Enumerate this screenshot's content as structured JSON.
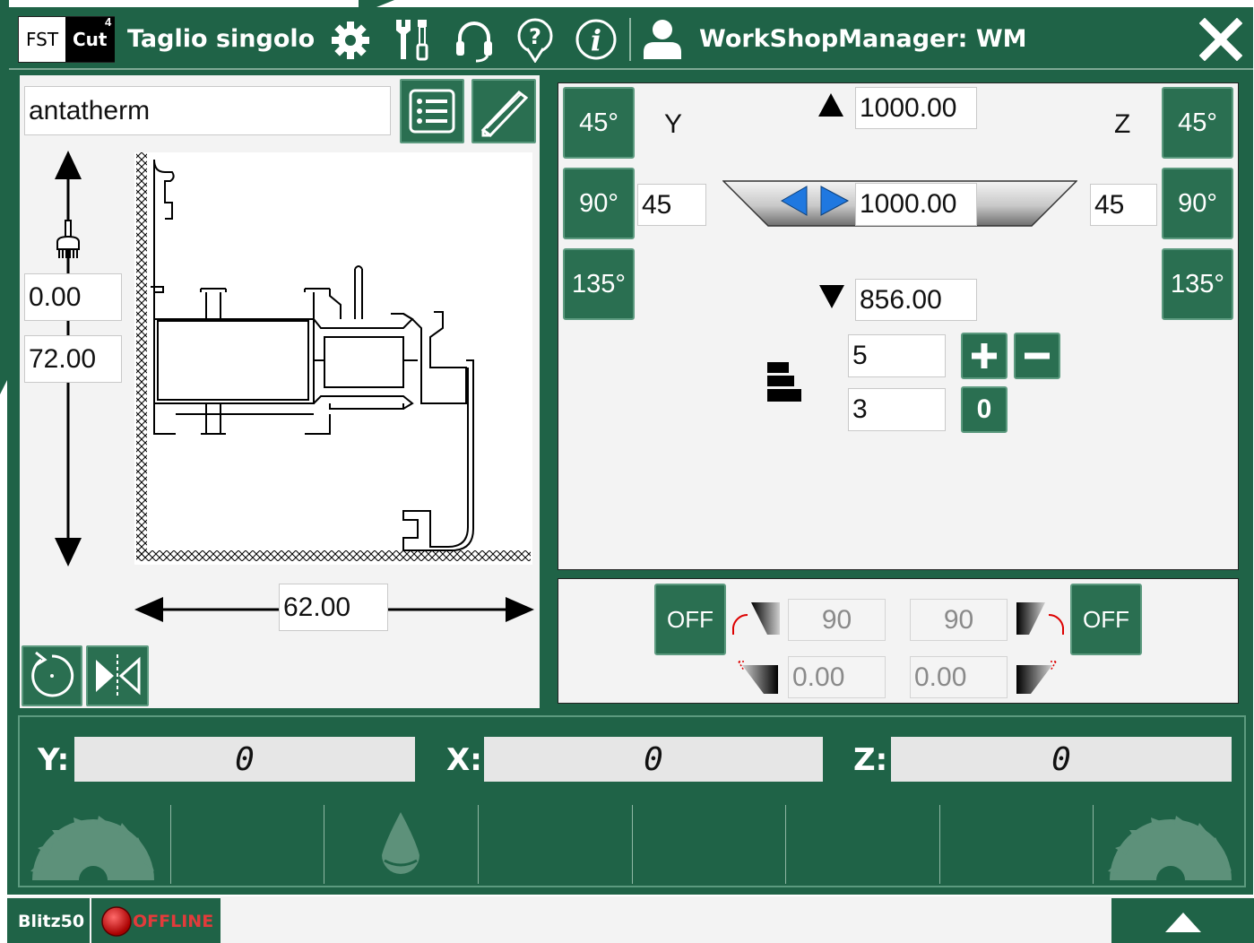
{
  "header": {
    "logo_fst": "FST",
    "logo_cut": "Cut",
    "logo_sup": "4",
    "title": "Taglio singolo",
    "user": "WorkShopManager: WM",
    "icons": [
      "gear-icon",
      "tools-icon",
      "headset-icon",
      "help-icon",
      "info-icon",
      "user-icon",
      "close-icon"
    ]
  },
  "profile": {
    "name": "antatherm",
    "height_top": "0.00",
    "height_value": "72.00",
    "width_value": "62.00"
  },
  "cut": {
    "y_label": "Y",
    "z_label": "Z",
    "angle_45": "45°",
    "angle_90": "90°",
    "angle_135": "135°",
    "y_angle": "45",
    "z_angle": "45",
    "length_top": "1000.00",
    "length_mid": "1000.00",
    "length_bottom": "856.00",
    "qty_total": "5",
    "qty_done": "3",
    "reset_label": "0"
  },
  "tilt": {
    "left_off": "OFF",
    "right_off": "OFF",
    "left_angle": "90",
    "right_angle": "90",
    "left_offset": "0.00",
    "right_offset": "0.00"
  },
  "axes": {
    "y_label": "Y:",
    "x_label": "X:",
    "z_label": "Z:",
    "y_value": "0",
    "x_value": "0",
    "z_value": "0"
  },
  "status": {
    "machine": "Blitz50",
    "connection": "OFFLINE"
  }
}
